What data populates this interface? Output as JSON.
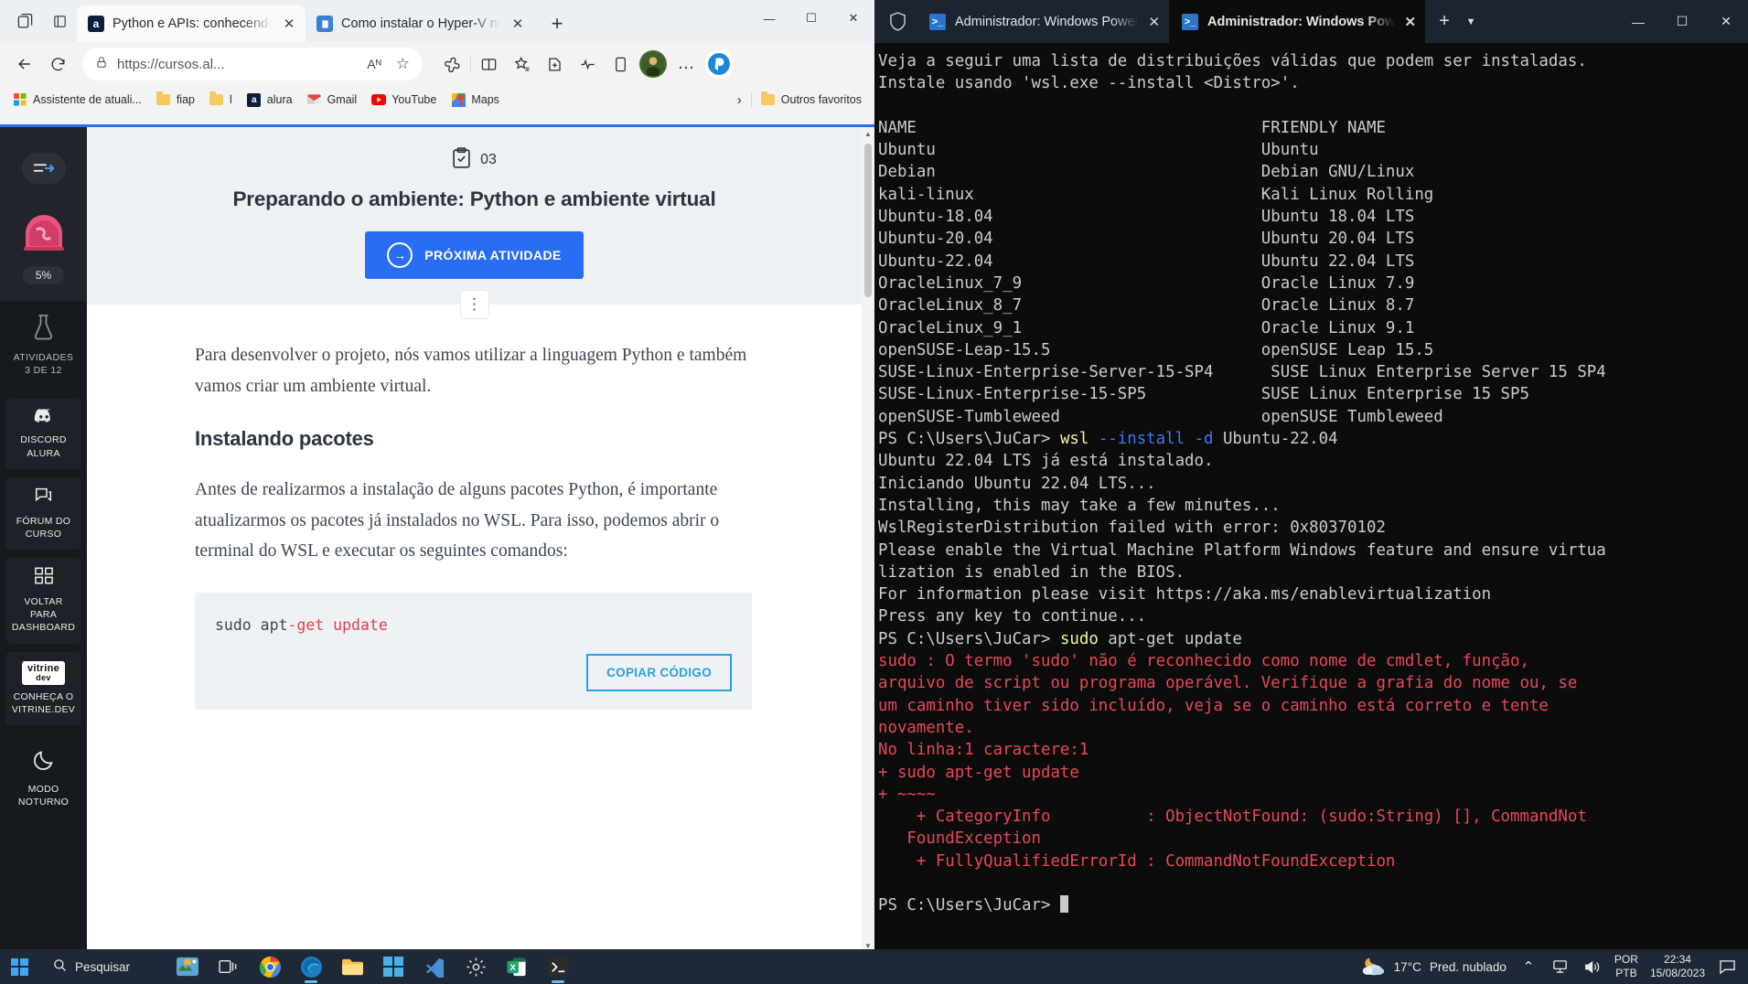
{
  "browser": {
    "tabs": [
      {
        "title": "Python e APIs: conhecendo a bi",
        "favicon": "alura-icon",
        "active": true,
        "close": "✕"
      },
      {
        "title": "Como instalar o Hyper-V no Wi",
        "favicon": "page-icon",
        "active": false,
        "close": "✕"
      }
    ],
    "new_tab_label": "+",
    "window_controls": {
      "minimize": "—",
      "maximize": "☐",
      "close": "✕"
    },
    "toolbar": {
      "back": "←",
      "refresh": "↻",
      "url": "https://cursos.al...",
      "read_aloud": "Aᴺ",
      "favorite": "☆",
      "more": "…"
    },
    "bookmarks": [
      {
        "label": "Assistente de atuali...",
        "icon": "windows-icon"
      },
      {
        "label": "fiap",
        "icon": "folder-icon"
      },
      {
        "label": "l",
        "icon": "folder-icon"
      },
      {
        "label": "alura",
        "icon": "alura-icon"
      },
      {
        "label": "Gmail",
        "icon": "gmail-icon"
      },
      {
        "label": "YouTube",
        "icon": "youtube-icon"
      },
      {
        "label": "Maps",
        "icon": "maps-icon"
      }
    ],
    "bookmarks_overflow": "›",
    "other_favorites": {
      "label": "Outros favoritos",
      "icon": "folder-icon"
    }
  },
  "course": {
    "sidebar": {
      "toggle_icon": "expand-arrow-icon",
      "progress_percent": "5%",
      "badge_icon": "achievement-badge-icon",
      "activities": {
        "icon": "flask-icon",
        "line1": "ATIVIDADES",
        "line2": "3 DE 12"
      },
      "cards": [
        {
          "icon": "discord-icon",
          "line1": "DISCORD",
          "line2": "ALURA"
        },
        {
          "icon": "forum-icon",
          "line1": "FÓRUM DO",
          "line2": "CURSO"
        },
        {
          "icon": "dashboard-icon",
          "line1": "VOLTAR",
          "line2": "PARA",
          "line3": "DASHBOARD"
        },
        {
          "icon": "vitrine-dev-logo",
          "logo_top": "vitrine",
          "logo_bottom": "dev",
          "line1": "CONHEÇA O",
          "line2": "VITRINE.DEV"
        },
        {
          "icon": "moon-icon",
          "line1": "MODO",
          "line2": "NOTURNO"
        }
      ]
    },
    "lesson": {
      "number": "03",
      "number_icon": "clipboard-check-icon",
      "title": "Preparando o ambiente: Python e ambiente virtual",
      "next_button": "PRÓXIMA ATIVIDADE",
      "next_button_icon": "arrow-right-circle-icon",
      "kebab_icon": "more-vertical-icon"
    },
    "article": {
      "paragraph1": "Para desenvolver o projeto, nós vamos utilizar a linguagem Python e também vamos criar um ambiente virtual.",
      "heading": "Instalando pacotes",
      "paragraph2": "Antes de realizarmos a instalação de alguns pacotes Python, é importante atualizarmos os pacotes já instalados no WSL. Para isso, podemos abrir o terminal do WSL e executar os seguintes comandos:",
      "code_plain1": "sudo apt",
      "code_kw": "-get update",
      "copy_button": "COPIAR CÓDIGO"
    },
    "scrollbar": {
      "up": "▲",
      "down": "▼"
    }
  },
  "terminal": {
    "shield_icon": "shield-icon",
    "tabs": [
      {
        "title": "Administrador: Windows Power",
        "active": false,
        "close": "✕",
        "icon": "powershell-icon"
      },
      {
        "title": "Administrador: Windows Powe",
        "active": true,
        "close": "✕",
        "icon": "powershell-icon"
      }
    ],
    "new_tab": "+",
    "dropdown": "⌄",
    "window_controls": {
      "minimize": "—",
      "maximize": "☐",
      "close": "✕"
    },
    "lines": [
      {
        "text": "Veja a seguir uma lista de distribuições válidas que podem ser instaladas.",
        "color": "normal"
      },
      {
        "text": "Instale usando 'wsl.exe --install <Distro>'.",
        "color": "normal"
      },
      {
        "text": "",
        "color": "normal"
      },
      {
        "text": "NAME                                    FRIENDLY NAME",
        "color": "normal"
      },
      {
        "text": "Ubuntu                                  Ubuntu",
        "color": "normal"
      },
      {
        "text": "Debian                                  Debian GNU/Linux",
        "color": "normal"
      },
      {
        "text": "kali-linux                              Kali Linux Rolling",
        "color": "normal"
      },
      {
        "text": "Ubuntu-18.04                            Ubuntu 18.04 LTS",
        "color": "normal"
      },
      {
        "text": "Ubuntu-20.04                            Ubuntu 20.04 LTS",
        "color": "normal"
      },
      {
        "text": "Ubuntu-22.04                            Ubuntu 22.04 LTS",
        "color": "normal"
      },
      {
        "text": "OracleLinux_7_9                         Oracle Linux 7.9",
        "color": "normal"
      },
      {
        "text": "OracleLinux_8_7                         Oracle Linux 8.7",
        "color": "normal"
      },
      {
        "text": "OracleLinux_9_1                         Oracle Linux 9.1",
        "color": "normal"
      },
      {
        "text": "openSUSE-Leap-15.5                      openSUSE Leap 15.5",
        "color": "normal"
      },
      {
        "text": "SUSE-Linux-Enterprise-Server-15-SP4      SUSE Linux Enterprise Server 15 SP4",
        "color": "normal"
      },
      {
        "text": "SUSE-Linux-Enterprise-15-SP5            SUSE Linux Enterprise 15 SP5",
        "color": "normal"
      },
      {
        "text": "openSUSE-Tumbleweed                     openSUSE Tumbleweed",
        "color": "normal"
      }
    ],
    "prompt1": {
      "prompt": "PS C:\\Users\\JuCar> ",
      "cmd_kw": "wsl",
      "cmd_param": " --install -d",
      "cmd_rest": " Ubuntu-22.04"
    },
    "after_prompt1": [
      "Ubuntu 22.04 LTS já está instalado.",
      "Iniciando Ubuntu 22.04 LTS...",
      "Installing, this may take a few minutes...",
      "WslRegisterDistribution failed with error: 0x80370102",
      "Please enable the Virtual Machine Platform Windows feature and ensure virtua",
      "lization is enabled in the BIOS.",
      "For information please visit https://aka.ms/enablevirtualization",
      "Press any key to continue..."
    ],
    "prompt2": {
      "prompt": "PS C:\\Users\\JuCar> ",
      "cmd_kw": "sudo",
      "cmd_rest": " apt-get update"
    },
    "error_lines": [
      "sudo : O termo 'sudo' não é reconhecido como nome de cmdlet, função,",
      "arquivo de script ou programa operável. Verifique a grafia do nome ou, se",
      "um caminho tiver sido incluído, veja se o caminho está correto e tente",
      "novamente.",
      "No linha:1 caractere:1",
      "+ sudo apt-get update",
      "+ ~~~~",
      "    + CategoryInfo          : ObjectNotFound: (sudo:String) [], CommandNot",
      "   FoundException",
      "    + FullyQualifiedErrorId : CommandNotFoundException"
    ],
    "prompt3": {
      "prompt": "PS C:\\Users\\JuCar> "
    }
  },
  "taskbar": {
    "start_icon": "windows-start-icon",
    "search": {
      "icon": "search-icon",
      "placeholder": "Pesquisar"
    },
    "apps": [
      {
        "name": "widgets-icon",
        "running": false
      },
      {
        "name": "task-view-icon",
        "running": false
      },
      {
        "name": "chrome-icon",
        "running": false
      },
      {
        "name": "edge-icon",
        "running": true
      },
      {
        "name": "file-explorer-icon",
        "running": false
      },
      {
        "name": "microsoft-store-icon",
        "running": false
      },
      {
        "name": "visual-studio-icon",
        "running": false
      },
      {
        "name": "settings-icon",
        "running": false
      },
      {
        "name": "excel-icon",
        "running": false
      },
      {
        "name": "windows-terminal-icon",
        "running": true
      }
    ],
    "tray": {
      "weather_icon": "partly-cloudy-night-icon",
      "temperature": "17°C",
      "weather_text": "Pred. nublado",
      "chevron": "⌃",
      "network_icon": "network-icon",
      "volume_icon": "volume-icon",
      "lang_line1": "POR",
      "lang_line2": "PTB",
      "time": "22:34",
      "date": "15/08/2023",
      "notification_icon": "notification-icon"
    }
  },
  "colors": {
    "accent_blue": "#2a6df5",
    "terminal_bg": "#0c0c0c",
    "terminal_error": "#e74856",
    "taskbar_bg": "#1f2836",
    "sidebar_dark": "#16191d"
  }
}
